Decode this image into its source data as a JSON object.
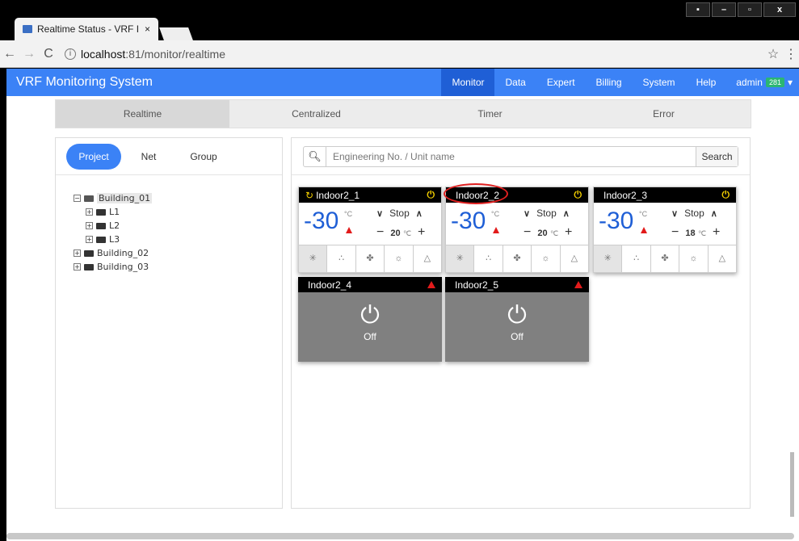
{
  "browser": {
    "tab_title": "Realtime Status - VRF I",
    "tab_close": "×",
    "url_host": "localhost",
    "url_rest": ":81/monitor/realtime",
    "win_min": "–",
    "win_max": "▫",
    "win_close": "x"
  },
  "navbar": {
    "brand": "VRF Monitoring System",
    "items": [
      "Monitor",
      "Data",
      "Expert",
      "Billing",
      "System",
      "Help"
    ],
    "user": "admin",
    "badge": "281"
  },
  "subtabs": [
    "Realtime",
    "Centralized",
    "Timer",
    "Error"
  ],
  "left_tabs": [
    "Project",
    "Net",
    "Group"
  ],
  "tree": {
    "building1": "Building_01",
    "l1": "L1",
    "l2": "L2",
    "l3": "L3",
    "building2": "Building_02",
    "building3": "Building_03"
  },
  "search": {
    "placeholder": "Engineering No. / Unit name",
    "button": "Search"
  },
  "units": [
    {
      "name": "Indoor2_1",
      "temp": "-30",
      "unit": "°C",
      "fan": "Stop",
      "set": "20",
      "state": "on"
    },
    {
      "name": "Indoor2_2",
      "temp": "-30",
      "unit": "°C",
      "fan": "Stop",
      "set": "20",
      "state": "on"
    },
    {
      "name": "Indoor2_3",
      "temp": "-30",
      "unit": "°C",
      "fan": "Stop",
      "set": "18",
      "state": "on"
    },
    {
      "name": "Indoor2_4",
      "state": "off",
      "off_label": "Off"
    },
    {
      "name": "Indoor2_5",
      "state": "off",
      "off_label": "Off"
    }
  ],
  "colors": {
    "accent": "#3b82f6",
    "alarm": "#e21b1b",
    "power": "#f5d000"
  }
}
